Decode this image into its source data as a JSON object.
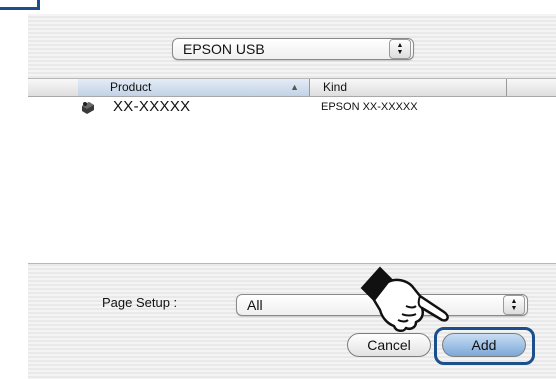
{
  "destination_popup": {
    "value": "EPSON USB"
  },
  "list": {
    "columns": [
      {
        "label": "Product"
      },
      {
        "label": "Kind"
      }
    ],
    "rows": [
      {
        "product": "XX-XXXXX",
        "kind": "EPSON XX-XXXXX"
      }
    ]
  },
  "page_setup": {
    "label": "Page Setup :",
    "value": "All"
  },
  "buttons": {
    "cancel": "Cancel",
    "add": "Add"
  },
  "icons": {
    "sort": "sort-ascending-icon",
    "printer": "printer-icon",
    "hand": "pointing-hand-icon"
  },
  "colors": {
    "highlight": "#1b4f8c",
    "default_button": "#7da8d8"
  }
}
